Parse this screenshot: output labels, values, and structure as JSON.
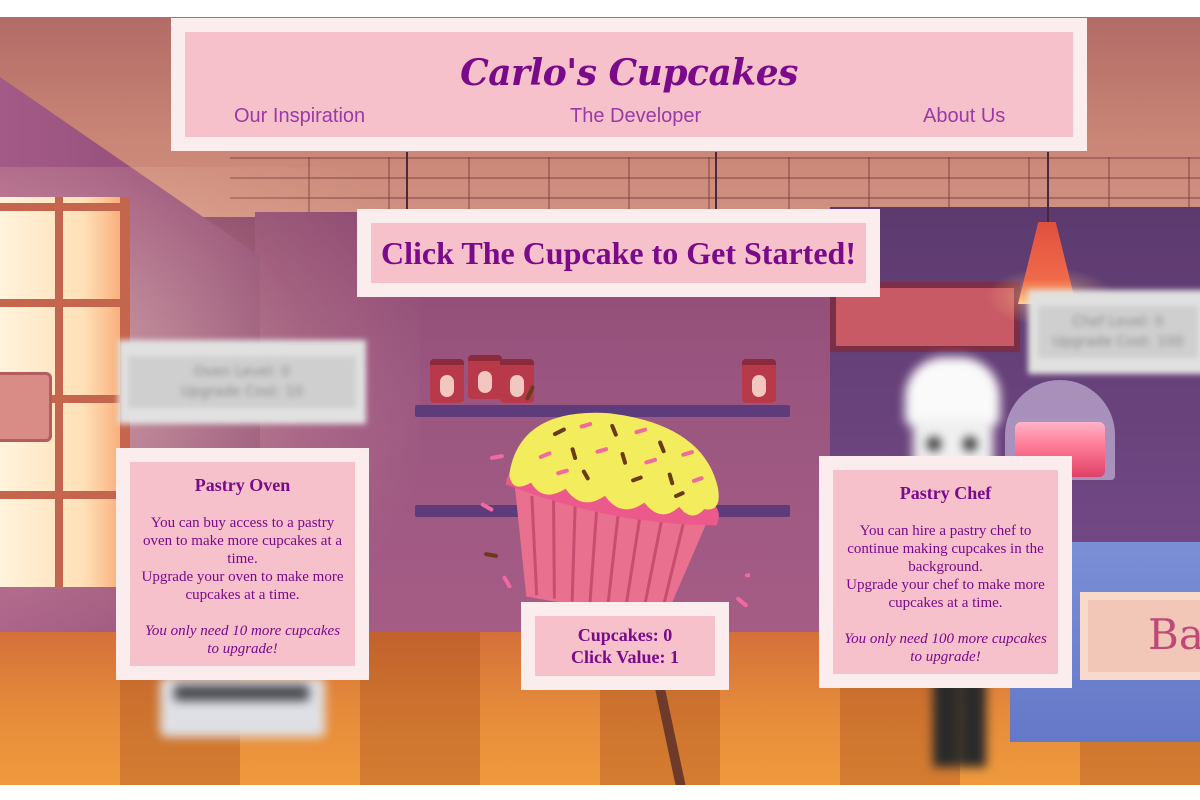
{
  "header": {
    "title": "Carlo's Cupcakes",
    "nav": [
      {
        "label": "Our Inspiration"
      },
      {
        "label": "The Developer"
      },
      {
        "label": "About Us"
      }
    ]
  },
  "prompt": {
    "text": "Click The Cupcake to Get Started!"
  },
  "upgrades": {
    "oven": {
      "title": "Pastry Oven",
      "description_1": "You can buy access to a pastry oven to make more cupcakes at a time.",
      "description_2": "Upgrade your oven to make more cupcakes at a time.",
      "note": "You only need 10 more cupcakes to upgrade!",
      "hidden_hint_1": "Oven Level: 0",
      "hidden_hint_2": "Upgrade Cost: 10"
    },
    "chef": {
      "title": "Pastry Chef",
      "description_1": "You can hire a pastry chef to continue making cupcakes in the background.",
      "description_2": "Upgrade your chef to make more cupcakes at a time.",
      "note": "You only need 100 more cupcakes to upgrade!",
      "hidden_hint_1": "Chef Level: 0",
      "hidden_hint_2": "Upgrade Cost: 100"
    }
  },
  "stats": {
    "cupcakes_label": "Cupcakes: 0",
    "click_value_label": "Click Value: 1"
  },
  "background": {
    "sign_text": "Ba"
  },
  "icons": {
    "cupcake": "cupcake-icon"
  },
  "colors": {
    "accent": "#7a0a8a",
    "panel": "#f6c1cb",
    "panel_border": "#fbecee"
  }
}
